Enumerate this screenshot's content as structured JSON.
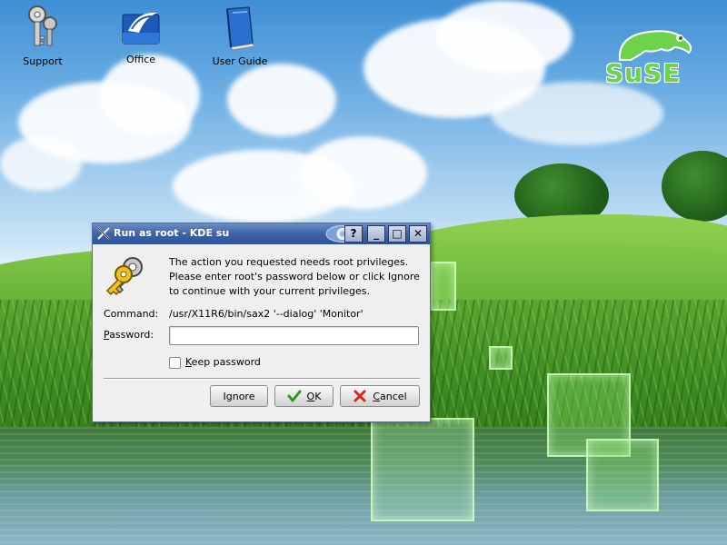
{
  "desktop": {
    "icons": [
      {
        "label": "Support",
        "icon": "keys-icon"
      },
      {
        "label": "Office",
        "icon": "office-icon"
      },
      {
        "label": "User Guide",
        "icon": "book-icon"
      }
    ],
    "logo_text": "SuSE"
  },
  "dialog": {
    "title": "Run as root - KDE su",
    "title_buttons": [
      "?",
      "_",
      "□",
      "✕"
    ],
    "message_lines": [
      "The action you requested needs root privileges.",
      "Please enter root's password below or click Ignore",
      "to continue with your current privileges."
    ],
    "command_label": "Command:",
    "command_value": "/usr/X11R6/bin/sax2 '--dialog' 'Monitor'",
    "password_label_u": "P",
    "password_label_rest": "assword:",
    "password_value": "",
    "keep_password_u": "K",
    "keep_password_rest": "eep password",
    "keep_password_checked": false,
    "buttons": {
      "ignore": "Ignore",
      "ok_u": "O",
      "ok_rest": "K",
      "cancel_u": "C",
      "cancel_rest": "ancel"
    }
  },
  "colors": {
    "titlebar": "#3d63a8",
    "dialog_bg": "#efefef",
    "suse_green": "#6fd24b"
  }
}
